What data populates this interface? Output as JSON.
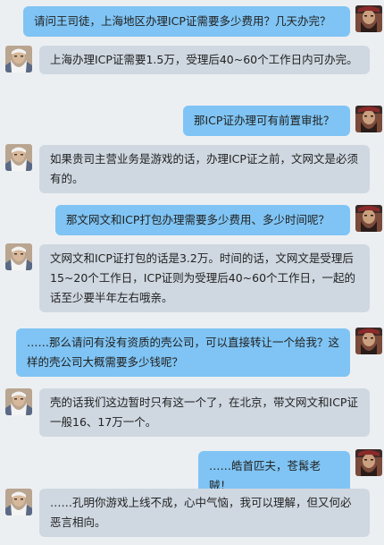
{
  "messages": [
    {
      "from": "user",
      "text": "请问王司徒，上海地区办理ICP证需要多少费用？几天办完？"
    },
    {
      "from": "reply",
      "text": "上海办理ICP证需要1.5万，受理后40~60个工作日内可办完。"
    },
    {
      "from": "user",
      "text": "那ICP证办理可有前置审批？"
    },
    {
      "from": "reply",
      "text": "如果贵司主营业务是游戏的话，办理ICP证之前，文网文是必须有的。"
    },
    {
      "from": "user",
      "text": "那文网文和ICP打包办理需要多少费用、多少时间呢？"
    },
    {
      "from": "reply",
      "text": "文网文和ICP证打包的话是3.2万。时间的话，文网文是受理后15~20个工作日，ICP证则为受理后40~60个工作日，一起的话至少要半年左右哦亲。"
    },
    {
      "from": "user",
      "text": "……那么请问有没有资质的壳公司，可以直接转让一个给我？这样的壳公司大概需要多少钱呢？"
    },
    {
      "from": "reply",
      "text": "壳的话我们这边暂时只有这一个了，在北京，带文网文和ICP证一般16、17万一个。"
    },
    {
      "from": "user",
      "text": "……皓首匹夫，苍髯老贼！"
    },
    {
      "from": "reply",
      "text": "……孔明你游戏上线不成，心中气恼，我可以理解，但又何必恶言相向。"
    }
  ],
  "colors": {
    "user_bubble": "#7fc4f4",
    "reply_bubble": "#cfd8e1",
    "background": "#eceff2"
  },
  "icons": {
    "user_avatar": "bearded-man-avatar",
    "reply_avatar": "white-haired-elder-avatar"
  }
}
